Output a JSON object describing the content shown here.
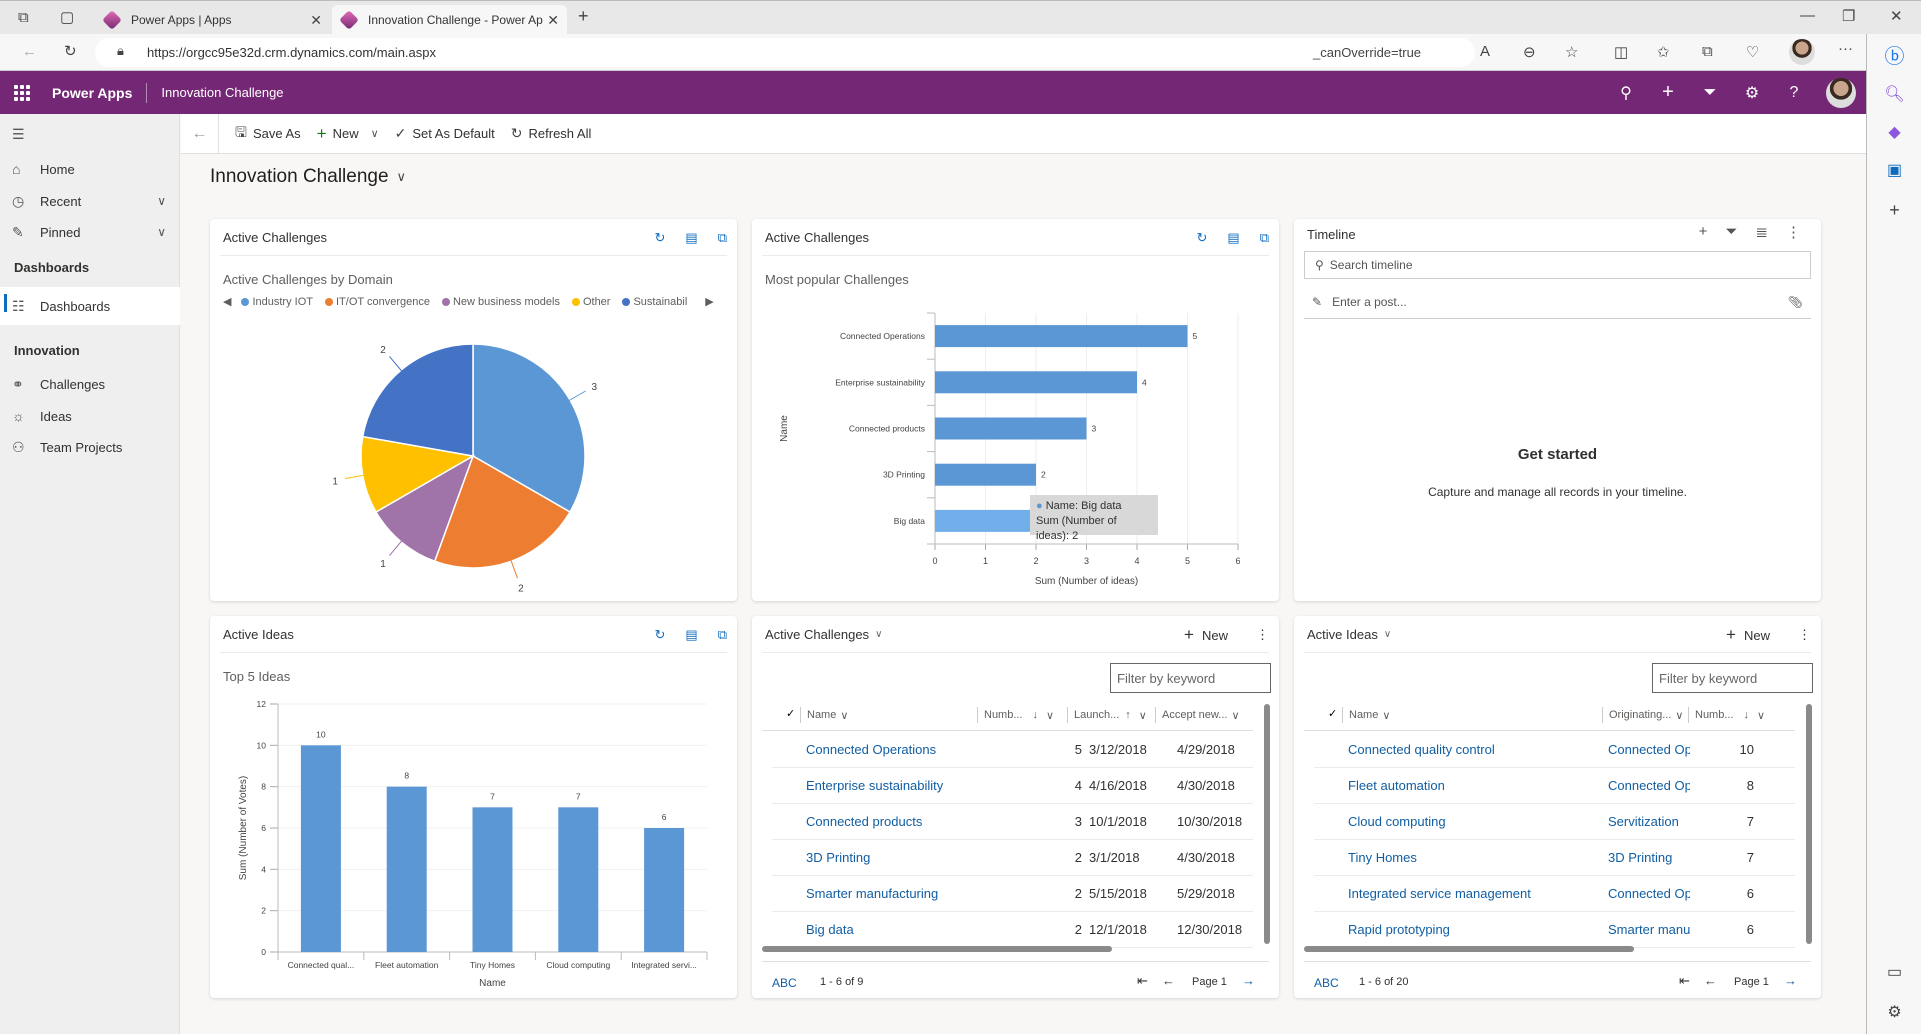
{
  "browser": {
    "tabs": [
      {
        "label": "Power Apps | Apps"
      },
      {
        "label": "Innovation Challenge - Power Ap"
      }
    ],
    "url": "https://orgcc95e32d.crm.dynamics.com/main.aspx",
    "url_suffix": "_canOverride=true"
  },
  "appbar": {
    "brand": "Power Apps",
    "app_name": "Innovation Challenge"
  },
  "nav": {
    "items": [
      {
        "label": "Home",
        "icon": "home-icon"
      },
      {
        "label": "Recent",
        "icon": "clock-icon"
      },
      {
        "label": "Pinned",
        "icon": "pin-icon"
      }
    ],
    "group_dashboards": "Dashboards",
    "dashboards_item": "Dashboards",
    "group_innovation": "Innovation",
    "innovation_items": [
      {
        "label": "Challenges"
      },
      {
        "label": "Ideas"
      },
      {
        "label": "Team Projects"
      }
    ]
  },
  "commands": {
    "save_as": "Save As",
    "new": "New",
    "set_default": "Set As Default",
    "refresh_all": "Refresh All"
  },
  "page": {
    "title": "Innovation Challenge"
  },
  "cards": {
    "pie": {
      "title": "Active Challenges",
      "subtitle": "Active Challenges by Domain"
    },
    "hbar": {
      "title": "Active Challenges",
      "subtitle": "Most popular Challenges",
      "tooltip_line1": "Name: Big data",
      "tooltip_line2": "Sum (Number of ideas): 2"
    },
    "timeline": {
      "title": "Timeline",
      "search_placeholder": "Search timeline",
      "post_placeholder": "Enter a post...",
      "empty_title": "Get started",
      "empty_text": "Capture and manage all records in your timeline."
    },
    "vbar": {
      "title": "Active Ideas",
      "subtitle": "Top 5 Ideas"
    },
    "challenges_grid": {
      "title": "Active Challenges",
      "new_label": "New",
      "filter_placeholder": "Filter by keyword",
      "columns": [
        "Name",
        "Numb...",
        "Launch...",
        "Accept new..."
      ],
      "rows": [
        [
          "Connected Operations",
          "5",
          "3/12/2018",
          "4/29/2018"
        ],
        [
          "Enterprise sustainability",
          "4",
          "4/16/2018",
          "4/30/2018"
        ],
        [
          "Connected products",
          "3",
          "10/1/2018",
          "10/30/2018"
        ],
        [
          "3D Printing",
          "2",
          "3/1/2018",
          "4/30/2018"
        ],
        [
          "Smarter manufacturing",
          "2",
          "5/15/2018",
          "5/29/2018"
        ],
        [
          "Big data",
          "2",
          "12/1/2018",
          "12/30/2018"
        ]
      ],
      "footer_abc": "ABC",
      "footer_count": "1 - 6 of 9",
      "footer_page": "Page 1"
    },
    "ideas_grid": {
      "title": "Active Ideas",
      "new_label": "New",
      "filter_placeholder": "Filter by keyword",
      "columns": [
        "Name",
        "Originating...",
        "Numb..."
      ],
      "rows": [
        [
          "Connected quality control",
          "Connected Ope",
          "10"
        ],
        [
          "Fleet automation",
          "Connected Ope",
          "8"
        ],
        [
          "Cloud computing",
          "Servitization",
          "7"
        ],
        [
          "Tiny Homes",
          "3D Printing",
          "7"
        ],
        [
          "Integrated service management",
          "Connected Ope",
          "6"
        ],
        [
          "Rapid prototyping",
          "Smarter manuf",
          "6"
        ]
      ],
      "footer_abc": "ABC",
      "footer_count": "1 - 6 of 20",
      "footer_page": "Page 1"
    }
  },
  "chart_data": [
    {
      "type": "pie",
      "title": "Active Challenges by Domain",
      "legend": "top",
      "categories": [
        "Industry IOT",
        "IT/OT convergence",
        "New business models",
        "Other",
        "Sustainability"
      ],
      "legend_labels": [
        "Industry IOT",
        "IT/OT convergence",
        "New business models",
        "Other",
        "Sustainabil"
      ],
      "values": [
        3,
        2,
        1,
        1,
        2
      ],
      "colors": [
        "#5b97d5",
        "#ed7d31",
        "#a074a8",
        "#ffc000",
        "#4472c4"
      ]
    },
    {
      "type": "bar",
      "orientation": "horizontal",
      "title": "Most popular Challenges",
      "categories": [
        "Connected Operations",
        "Enterprise sustainability",
        "Connected products",
        "3D Printing",
        "Big data"
      ],
      "values": [
        5,
        4,
        3,
        2,
        2
      ],
      "xlabel": "Sum (Number of ideas)",
      "ylabel": "Name",
      "xlim": [
        0,
        6
      ],
      "xticks": [
        0,
        1,
        2,
        3,
        4,
        5,
        6
      ],
      "color": "#5b97d5",
      "highlight_color": "#72aeea",
      "highlight_index": 4,
      "grid": true
    },
    {
      "type": "bar",
      "title": "Top 5 Ideas",
      "categories": [
        "Connected qual...",
        "Fleet automation",
        "Tiny Homes",
        "Cloud computing",
        "Integrated servi..."
      ],
      "values": [
        10,
        8,
        7,
        7,
        6
      ],
      "xlabel": "Name",
      "ylabel": "Sum (Number of Votes)",
      "ylim": [
        0,
        12
      ],
      "yticks": [
        0,
        2,
        4,
        6,
        8,
        10,
        12
      ],
      "color": "#5b97d5",
      "grid": true
    }
  ]
}
